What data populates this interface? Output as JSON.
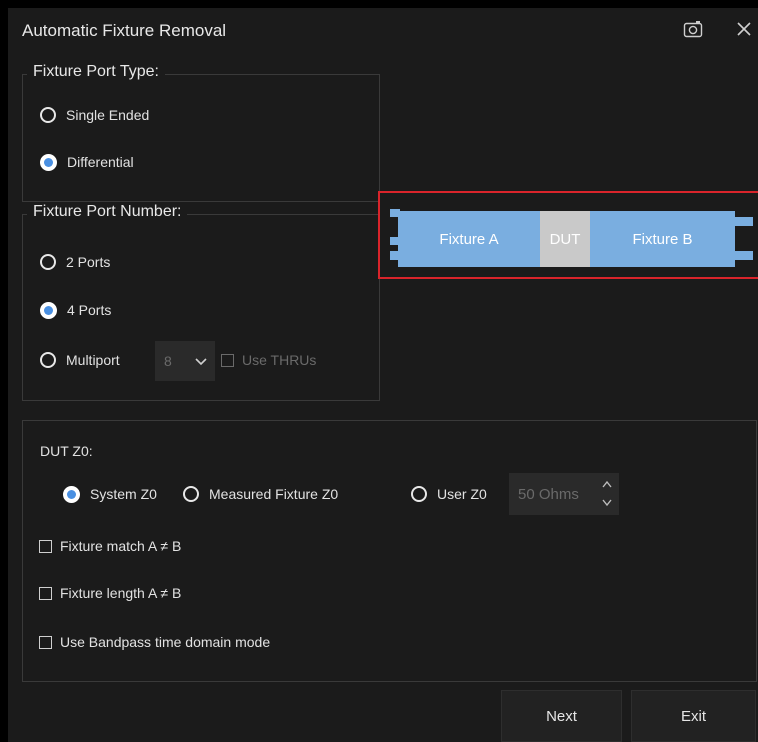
{
  "dialog": {
    "title": "Automatic Fixture Removal",
    "camera_icon": "camera-icon",
    "close_icon": "close-icon"
  },
  "port_type": {
    "legend": "Fixture Port Type:",
    "options": [
      {
        "label": "Single Ended",
        "selected": false
      },
      {
        "label": "Differential",
        "selected": true
      }
    ]
  },
  "port_number": {
    "legend": "Fixture Port Number:",
    "options": [
      {
        "label": "2 Ports",
        "selected": false
      },
      {
        "label": "4 Ports",
        "selected": true
      },
      {
        "label": "Multiport",
        "selected": false
      }
    ],
    "multiport_count": "8",
    "use_thrus_label": "Use THRUs",
    "use_thrus_checked": false
  },
  "diagram": {
    "fixture_a": "Fixture A",
    "dut": "DUT",
    "fixture_b": "Fixture B",
    "fixture_color": "#7aaee0",
    "dut_color": "#c9c9c9",
    "highlight_color": "#d9242b"
  },
  "dut_z0": {
    "label": "DUT Z0:",
    "options": [
      {
        "label": "System Z0",
        "selected": true
      },
      {
        "label": "Measured Fixture Z0",
        "selected": false
      },
      {
        "label": "User Z0",
        "selected": false
      }
    ],
    "user_z0_value": "50 Ohms"
  },
  "checks": [
    {
      "label": "Fixture match A ≠ B",
      "checked": false
    },
    {
      "label": "Fixture length A ≠ B",
      "checked": false
    },
    {
      "label": "Use Bandpass time domain mode",
      "checked": false
    }
  ],
  "buttons": {
    "next": "Next",
    "exit": "Exit"
  },
  "accent_color": "#4a90e2"
}
